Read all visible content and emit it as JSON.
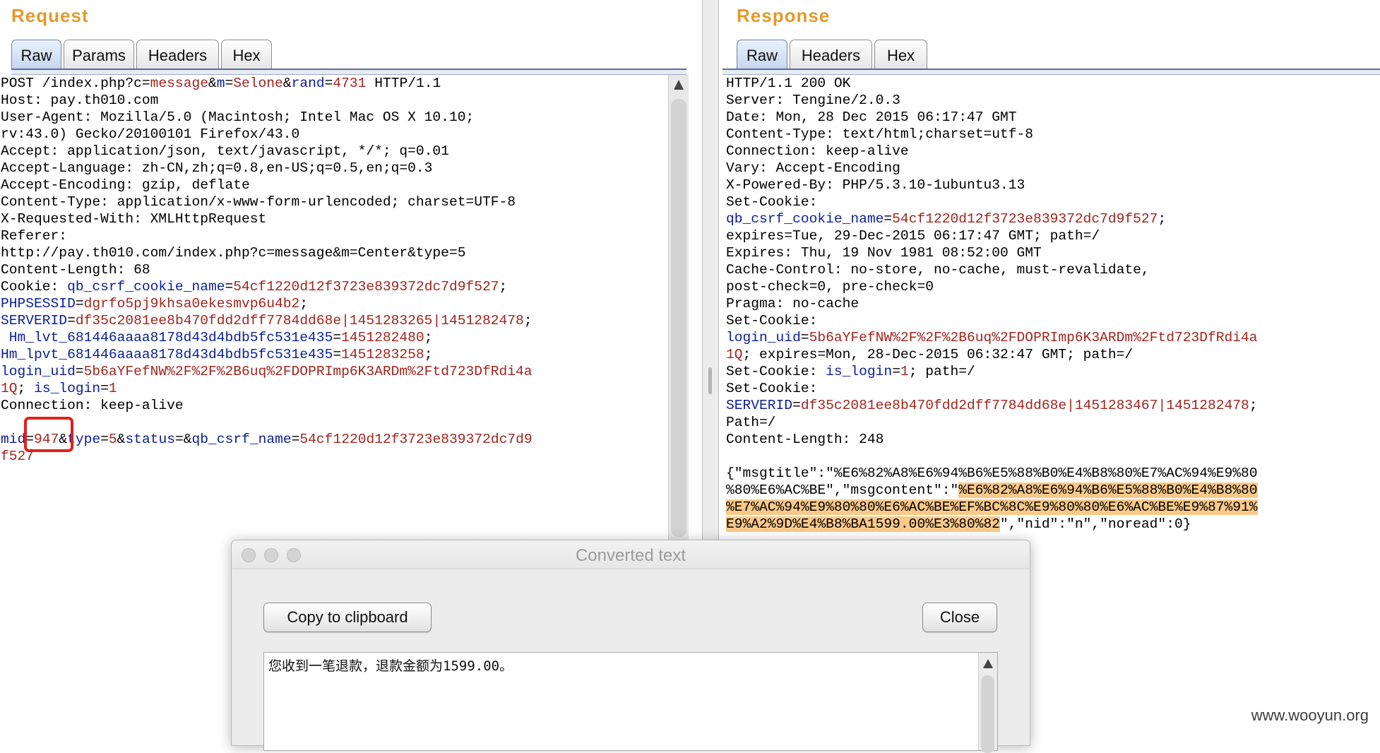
{
  "colors": {
    "title_orange": "#e49a2b",
    "key_blue": "#0a1e9b",
    "value_red": "#a2241d",
    "highlight": "#f9c98a",
    "callout_red": "#e0211b"
  },
  "request": {
    "title": "Request",
    "tabs": [
      {
        "label": "Raw",
        "active": true
      },
      {
        "label": "Params",
        "active": false
      },
      {
        "label": "Headers",
        "active": false
      },
      {
        "label": "Hex",
        "active": false
      }
    ],
    "lines": [
      [
        {
          "t": "POST /index.php?c="
        },
        {
          "t": "message",
          "c": "v"
        },
        {
          "t": "&"
        },
        {
          "t": "m",
          "c": "k"
        },
        {
          "t": "="
        },
        {
          "t": "Selone",
          "c": "v"
        },
        {
          "t": "&"
        },
        {
          "t": "rand",
          "c": "k"
        },
        {
          "t": "="
        },
        {
          "t": "4731",
          "c": "v"
        },
        {
          "t": " HTTP/1.1"
        }
      ],
      [
        {
          "t": "Host: pay.th010.com"
        }
      ],
      [
        {
          "t": "User-Agent: Mozilla/5.0 (Macintosh; Intel Mac OS X 10.10;"
        }
      ],
      [
        {
          "t": "rv:43.0) Gecko/20100101 Firefox/43.0"
        }
      ],
      [
        {
          "t": "Accept: application/json, text/javascript, */*; q=0.01"
        }
      ],
      [
        {
          "t": "Accept-Language: zh-CN,zh;q=0.8,en-US;q=0.5,en;q=0.3"
        }
      ],
      [
        {
          "t": "Accept-Encoding: gzip, deflate"
        }
      ],
      [
        {
          "t": "Content-Type: application/x-www-form-urlencoded; charset=UTF-8"
        }
      ],
      [
        {
          "t": "X-Requested-With: XMLHttpRequest"
        }
      ],
      [
        {
          "t": "Referer:"
        }
      ],
      [
        {
          "t": "http://pay.th010.com/index.php?c=message&m=Center&type=5"
        }
      ],
      [
        {
          "t": "Content-Length: 68"
        }
      ],
      [
        {
          "t": "Cookie: "
        },
        {
          "t": "qb_csrf_cookie_name",
          "c": "k"
        },
        {
          "t": "="
        },
        {
          "t": "54cf1220d12f3723e839372dc7d9f527",
          "c": "v"
        },
        {
          "t": ";"
        }
      ],
      [
        {
          "t": "PHPSESSID",
          "c": "k"
        },
        {
          "t": "="
        },
        {
          "t": "dgrfo5pj9khsa0ekesmvp6u4b2",
          "c": "v"
        },
        {
          "t": ";"
        }
      ],
      [
        {
          "t": "SERVERID",
          "c": "k"
        },
        {
          "t": "="
        },
        {
          "t": "df35c2081ee8b470fdd2dff7784dd68e|1451283265|1451282478",
          "c": "v"
        },
        {
          "t": ";"
        }
      ],
      [
        {
          "t": " Hm_lvt_681446aaaa8178d43d4bdb5fc531e435",
          "c": "k"
        },
        {
          "t": "="
        },
        {
          "t": "1451282480",
          "c": "v"
        },
        {
          "t": ";"
        }
      ],
      [
        {
          "t": "Hm_lpvt_681446aaaa8178d43d4bdb5fc531e435",
          "c": "k"
        },
        {
          "t": "="
        },
        {
          "t": "1451283258",
          "c": "v"
        },
        {
          "t": ";"
        }
      ],
      [
        {
          "t": "login_uid",
          "c": "k"
        },
        {
          "t": "="
        },
        {
          "t": "5b6aYFefNW%2F%2F%2B6uq%2FDOPRImp6K3ARDm%2Ftd723DfRdi4a",
          "c": "v"
        }
      ],
      [
        {
          "t": "1Q",
          "c": "v"
        },
        {
          "t": "; "
        },
        {
          "t": "is_login",
          "c": "k"
        },
        {
          "t": "="
        },
        {
          "t": "1",
          "c": "v"
        }
      ],
      [
        {
          "t": "Connection: keep-alive"
        }
      ],
      [
        {
          "t": ""
        }
      ],
      [
        {
          "t": "mid",
          "c": "k"
        },
        {
          "t": "="
        },
        {
          "t": "947",
          "c": "v"
        },
        {
          "t": "&"
        },
        {
          "t": "type",
          "c": "k"
        },
        {
          "t": "="
        },
        {
          "t": "5",
          "c": "v"
        },
        {
          "t": "&"
        },
        {
          "t": "status",
          "c": "k"
        },
        {
          "t": "=&"
        },
        {
          "t": "qb_csrf_name",
          "c": "k"
        },
        {
          "t": "="
        },
        {
          "t": "54cf1220d12f3723e839372dc7d9",
          "c": "v"
        }
      ],
      [
        {
          "t": "f527",
          "c": "v"
        }
      ]
    ]
  },
  "response": {
    "title": "Response",
    "tabs": [
      {
        "label": "Raw",
        "active": true
      },
      {
        "label": "Headers",
        "active": false
      },
      {
        "label": "Hex",
        "active": false
      }
    ],
    "lines": [
      [
        {
          "t": "HTTP/1.1 200 OK"
        }
      ],
      [
        {
          "t": "Server: Tengine/2.0.3"
        }
      ],
      [
        {
          "t": "Date: Mon, 28 Dec 2015 06:17:47 GMT"
        }
      ],
      [
        {
          "t": "Content-Type: text/html;charset=utf-8"
        }
      ],
      [
        {
          "t": "Connection: keep-alive"
        }
      ],
      [
        {
          "t": "Vary: Accept-Encoding"
        }
      ],
      [
        {
          "t": "X-Powered-By: PHP/5.3.10-1ubuntu3.13"
        }
      ],
      [
        {
          "t": "Set-Cookie:"
        }
      ],
      [
        {
          "t": "qb_csrf_cookie_name",
          "c": "k"
        },
        {
          "t": "="
        },
        {
          "t": "54cf1220d12f3723e839372dc7d9f527",
          "c": "v"
        },
        {
          "t": ";"
        }
      ],
      [
        {
          "t": "expires=Tue, 29-Dec-2015 06:17:47 GMT; path=/"
        }
      ],
      [
        {
          "t": "Expires: Thu, 19 Nov 1981 08:52:00 GMT"
        }
      ],
      [
        {
          "t": "Cache-Control: no-store, no-cache, must-revalidate,"
        }
      ],
      [
        {
          "t": "post-check=0, pre-check=0"
        }
      ],
      [
        {
          "t": "Pragma: no-cache"
        }
      ],
      [
        {
          "t": "Set-Cookie:"
        }
      ],
      [
        {
          "t": "login_uid",
          "c": "k"
        },
        {
          "t": "="
        },
        {
          "t": "5b6aYFefNW%2F%2F%2B6uq%2FDOPRImp6K3ARDm%2Ftd723DfRdi4a",
          "c": "v"
        }
      ],
      [
        {
          "t": "1Q",
          "c": "v"
        },
        {
          "t": "; expires=Mon, 28-Dec-2015 06:32:47 GMT; path=/"
        }
      ],
      [
        {
          "t": "Set-Cookie: "
        },
        {
          "t": "is_login",
          "c": "k"
        },
        {
          "t": "="
        },
        {
          "t": "1",
          "c": "v"
        },
        {
          "t": "; path=/"
        }
      ],
      [
        {
          "t": "Set-Cookie:"
        }
      ],
      [
        {
          "t": "SERVERID",
          "c": "k"
        },
        {
          "t": "="
        },
        {
          "t": "df35c2081ee8b470fdd2dff7784dd68e|1451283467|1451282478",
          "c": "v"
        },
        {
          "t": ";"
        }
      ],
      [
        {
          "t": "Path=/"
        }
      ],
      [
        {
          "t": "Content-Length: 248"
        }
      ],
      [
        {
          "t": ""
        }
      ],
      [
        {
          "t": "{\"msgtitle\":\"%E6%82%A8%E6%94%B6%E5%88%B0%E4%B8%80%E7%AC%94%E9%80"
        }
      ],
      [
        {
          "t": "%80%E6%AC%BE\",\"msgcontent\":\""
        },
        {
          "t": "%E6%82%A8%E6%94%B6%E5%88%B0%E4%B8%80",
          "c": "hl"
        }
      ],
      [
        {
          "t": "%E7%AC%94%E9%80%80%E6%AC%BE%EF%BC%8C%E9%80%80%E6%AC%BE%E9%87%91%",
          "c": "hl"
        }
      ],
      [
        {
          "t": "E9%A2%9D%E4%B8%BA1599.00%E3%80%82",
          "c": "hl"
        },
        {
          "t": "\",\"nid\":\"n\",\"noread\":0}"
        }
      ]
    ]
  },
  "dialog": {
    "title": "Converted text",
    "copy_label": "Copy to clipboard",
    "close_label": "Close",
    "text": "您收到一笔退款，退款金额为1599.00。"
  },
  "watermark": "www.wooyun.org"
}
